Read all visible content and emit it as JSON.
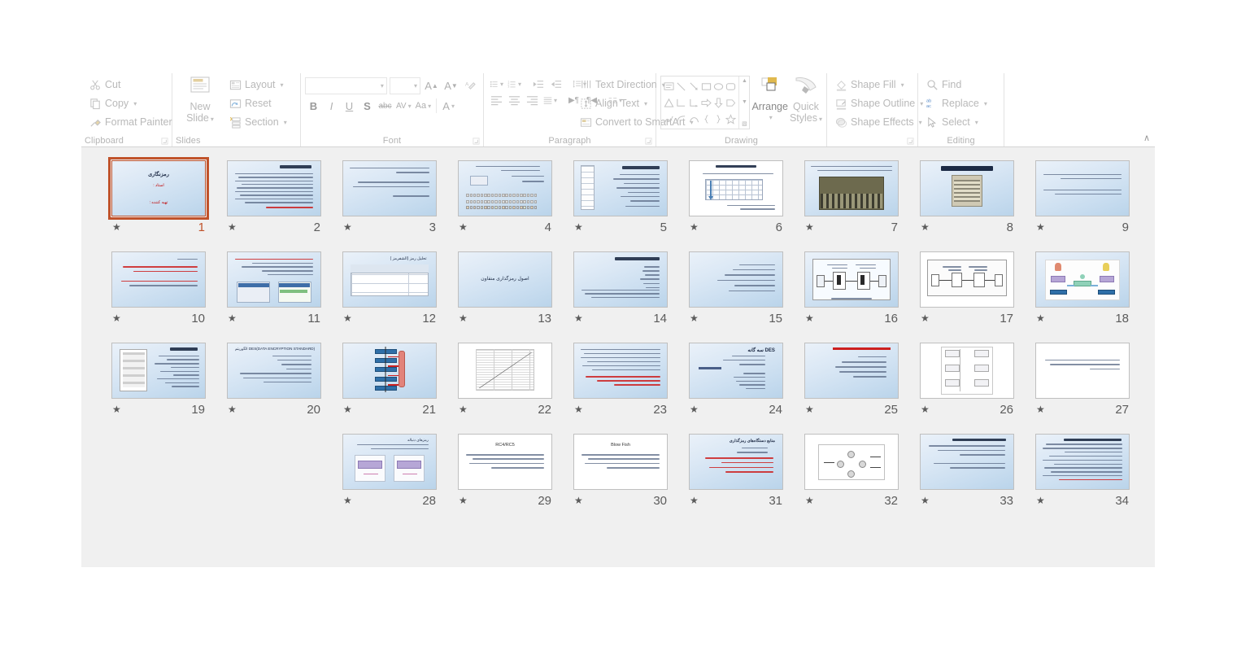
{
  "app": {
    "name": "PowerPoint Slide Sorter"
  },
  "ribbon": {
    "groups": [
      {
        "id": "clipboard",
        "label": "Clipboard"
      },
      {
        "id": "slides",
        "label": "Slides"
      },
      {
        "id": "font",
        "label": "Font"
      },
      {
        "id": "paragraph",
        "label": "Paragraph"
      },
      {
        "id": "drawing",
        "label": "Drawing"
      },
      {
        "id": "editing",
        "label": "Editing"
      }
    ],
    "clipboard": {
      "label": "Clipboard",
      "items": [
        {
          "label": "Cut",
          "icon": "scissors-icon"
        },
        {
          "label": "Copy",
          "icon": "copy-icon",
          "caret": "▾"
        },
        {
          "label": "Format Painter",
          "icon": "format-painter-icon"
        }
      ]
    },
    "slides": {
      "label": "Slides",
      "new_slide_label": "New\nSlide",
      "new_slide_line1": "New",
      "new_slide_line2": "Slide",
      "new_slide_caret": "▾",
      "items": [
        {
          "label": "Layout",
          "icon": "layout-icon",
          "caret": "▾"
        },
        {
          "label": "Reset",
          "icon": "reset-icon",
          "caret": ""
        },
        {
          "label": "Section",
          "icon": "section-icon",
          "caret": "▾"
        }
      ]
    },
    "font": {
      "label": "Font",
      "font_name_value": "",
      "font_size_value": "",
      "font_name_placeholder": "",
      "grow_font": "A",
      "shrink_font": "A",
      "clear_formatting": "clear-formatting-icon",
      "bold": "B",
      "italic": "I",
      "underline": "U",
      "shadow": "S",
      "strikethrough": "abc",
      "character_spacing": "AV",
      "change_case": "Aa",
      "font_color": "A",
      "caret": "▾"
    },
    "paragraph": {
      "label": "Paragraph",
      "items": [
        {
          "label": "Text Direction",
          "icon": "text-direction-icon",
          "caret": "▾"
        },
        {
          "label": "Align Text",
          "icon": "align-text-icon",
          "caret": "▾"
        },
        {
          "label": "Convert to SmartArt",
          "icon": "smartart-icon",
          "caret": "▾"
        }
      ]
    },
    "drawing": {
      "label": "Drawing",
      "arrange_label": "Arrange",
      "quick_styles_line1": "Quick",
      "quick_styles_line2": "Styles",
      "caret": "▾",
      "items": [
        {
          "label": "Shape Fill",
          "icon": "shape-fill-icon",
          "caret": "▾"
        },
        {
          "label": "Shape Outline",
          "icon": "shape-outline-icon",
          "caret": "▾"
        },
        {
          "label": "Shape Effects",
          "icon": "shape-effects-icon",
          "caret": "▾"
        }
      ]
    },
    "editing": {
      "label": "Editing",
      "items": [
        {
          "label": "Find",
          "icon": "find-icon",
          "caret": ""
        },
        {
          "label": "Replace",
          "icon": "replace-icon",
          "caret": "▾"
        },
        {
          "label": "Select",
          "icon": "select-icon",
          "caret": "▾"
        }
      ]
    },
    "collapse_caret": "∧"
  },
  "colors": {
    "selection_border": "#c0522a",
    "sorter_background": "#f0f0f0",
    "ribbon_text": "#b9b9b9",
    "slide_number": "#5b5b5b",
    "slide_gradient_start": "#eaf1f9",
    "slide_gradient_end": "#bad4ea"
  },
  "sorter": {
    "star_glyph": "★",
    "rows": [
      {
        "slides": [
          {
            "number": "9",
            "kind": "text-two-paragraph",
            "bg": "grad",
            "selected": false
          },
          {
            "number": "8",
            "kind": "title-image",
            "bg": "grad",
            "selected": false
          },
          {
            "number": "7",
            "kind": "title-photo",
            "bg": "grad",
            "selected": false
          },
          {
            "number": "6",
            "kind": "title-table-grid",
            "bg": "white",
            "selected": false
          },
          {
            "number": "5",
            "kind": "title-bullets-table",
            "bg": "grad",
            "selected": false
          },
          {
            "number": "4",
            "kind": "charmap",
            "bg": "grad",
            "selected": false
          },
          {
            "number": "3",
            "kind": "plain-paragraphs",
            "bg": "grad",
            "selected": false
          },
          {
            "number": "2",
            "kind": "title-dense-text",
            "bg": "grad",
            "selected": false,
            "title": "تاریخچه رمزنگاری"
          },
          {
            "number": "1",
            "kind": "title-slide-red",
            "bg": "grad",
            "selected": true,
            "title": "رمزنگاری",
            "sub1": "استاد :",
            "sub2": "تهیه کننده :"
          }
        ]
      },
      {
        "slides": [
          {
            "number": "18",
            "kind": "network-diagram",
            "bg": "grad",
            "selected": false
          },
          {
            "number": "17",
            "kind": "bw-block-diagram",
            "bg": "white",
            "selected": false
          },
          {
            "number": "16",
            "kind": "crypto-flow",
            "bg": "grad",
            "selected": false
          },
          {
            "number": "15",
            "kind": "bullet-list",
            "bg": "grad",
            "selected": false
          },
          {
            "number": "14",
            "kind": "title-right-list",
            "bg": "grad",
            "selected": false
          },
          {
            "number": "13",
            "kind": "section-title",
            "bg": "grad",
            "selected": false,
            "title": "اصول رمزگذاری متقاون"
          },
          {
            "number": "12",
            "kind": "data-table",
            "bg": "grad",
            "selected": false,
            "title": "تحلیل رمز (الشفرمز )"
          },
          {
            "number": "11",
            "kind": "two-screenshots",
            "bg": "grad",
            "selected": false
          },
          {
            "number": "10",
            "kind": "red-highlight-text",
            "bg": "grad",
            "selected": false
          }
        ]
      },
      {
        "slides": [
          {
            "number": "27",
            "kind": "white-paragraph",
            "bg": "white",
            "selected": false
          },
          {
            "number": "26",
            "kind": "white-flowchart",
            "bg": "white",
            "selected": false
          },
          {
            "number": "25",
            "kind": "red-title-bullets",
            "bg": "grad",
            "selected": false
          },
          {
            "number": "24",
            "kind": "des-triple",
            "bg": "grad",
            "selected": false,
            "title": "DES سه گانه"
          },
          {
            "number": "23",
            "kind": "dense-text-red",
            "bg": "grad",
            "selected": false
          },
          {
            "number": "22",
            "kind": "line-chart",
            "bg": "white",
            "selected": false
          },
          {
            "number": "21",
            "kind": "feistel-diagram",
            "bg": "grad",
            "selected": false
          },
          {
            "number": "20",
            "kind": "des-standard",
            "bg": "grad",
            "selected": false,
            "title": "(DATA ENCRYPTION STANDARD)DES الگوریتم"
          },
          {
            "number": "19",
            "kind": "structure-image",
            "bg": "grad",
            "selected": false
          }
        ]
      },
      {
        "slides": [
          {
            "number": "34",
            "kind": "dense-qa",
            "bg": "grad",
            "selected": false
          },
          {
            "number": "33",
            "kind": "short-qa",
            "bg": "grad",
            "selected": false
          },
          {
            "number": "32",
            "kind": "white-network",
            "bg": "white",
            "selected": false
          },
          {
            "number": "31",
            "kind": "red-attack-list",
            "bg": "grad",
            "selected": false,
            "title": "منابع دستگاه‌های رمزگذاری"
          },
          {
            "number": "30",
            "kind": "white-title-text",
            "bg": "white",
            "selected": false,
            "title": "Blow Fish"
          },
          {
            "number": "29",
            "kind": "white-title-text",
            "bg": "white",
            "selected": false,
            "title": "RC4/RC5"
          },
          {
            "number": "28",
            "kind": "diagram-pair",
            "bg": "grad",
            "selected": false,
            "title": "رمزهای دنباله"
          }
        ]
      }
    ]
  }
}
